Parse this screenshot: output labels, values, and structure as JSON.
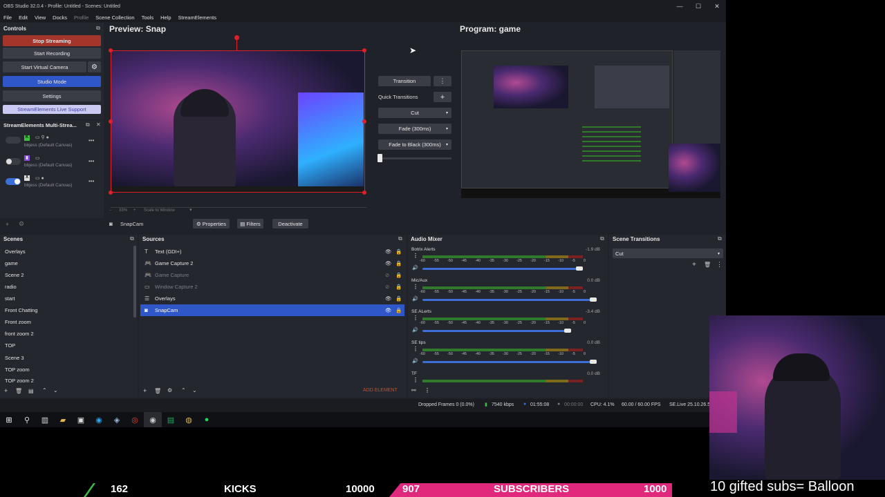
{
  "window": {
    "title": "OBS Studio 32.0.4 - Profile: Untitled - Scenes: Untitled",
    "minimize": "—",
    "maximize": "☐",
    "close": "✕"
  },
  "menu": [
    "File",
    "Edit",
    "View",
    "Docks",
    "Profile",
    "Scene Collection",
    "Tools",
    "Help",
    "StreamElements"
  ],
  "controls": {
    "title": "Controls",
    "stop_streaming": "Stop Streaming",
    "start_recording": "Start Recording",
    "start_virtual_camera": "Start Virtual Camera",
    "studio_mode": "Studio Mode",
    "settings": "Settings",
    "live_support": "StreamElements Live Support"
  },
  "multistream": {
    "title": "StreamElements Multi-Strea...",
    "rows": [
      {
        "label": "bbjess (Default Canvas)"
      },
      {
        "label": "bbjess (Default Canvas)"
      },
      {
        "label": "bbjess (Default Canvas)"
      }
    ]
  },
  "preview": {
    "title": "Preview: Snap",
    "zoom": "33%",
    "scale": "Scale to Window"
  },
  "program": {
    "title": "Program: game"
  },
  "transitions_center": {
    "transition": "Transition",
    "quick_transitions": "Quick Transitions",
    "cut": "Cut",
    "fade": "Fade (300ms)",
    "fade_black": "Fade to Black (300ms)"
  },
  "source_toolbar": {
    "source_name": "SnapCam",
    "properties": "Properties",
    "filters": "Filters",
    "deactivate": "Deactivate"
  },
  "scenes": {
    "title": "Scenes",
    "items": [
      "Overlays",
      "game",
      "Scene 2",
      "radio",
      "start",
      "Front Chatting",
      "Front zoom",
      "front zoom 2",
      "TOP",
      "Scene 3",
      "TOP zoom",
      "TOP zoom 2"
    ]
  },
  "sources": {
    "title": "Sources",
    "items": [
      {
        "name": "Text (GDI+)",
        "icon": "text-icon",
        "glyph": "T"
      },
      {
        "name": "Game Capture 2",
        "icon": "gamepad-icon",
        "glyph": "🎮"
      },
      {
        "name": "Game Capture",
        "icon": "gamepad-icon",
        "glyph": "🎮"
      },
      {
        "name": "Window Capture 2",
        "icon": "window-icon",
        "glyph": "▭"
      },
      {
        "name": "Overlays",
        "icon": "list-icon",
        "glyph": "☰"
      },
      {
        "name": "SnapCam",
        "icon": "camera-icon",
        "glyph": "◙"
      }
    ],
    "add_element": "ADD ELEMENT"
  },
  "mixer": {
    "title": "Audio Mixer",
    "ticks": [
      "-60",
      "-55",
      "-50",
      "-45",
      "-40",
      "-35",
      "-30",
      "-25",
      "-20",
      "-15",
      "-10",
      "-5",
      "0"
    ],
    "channels": [
      {
        "name": "Botrix Alerts",
        "db": "-1.9 dB",
        "level": 0.92
      },
      {
        "name": "Mic/Aux",
        "db": "0.0 dB",
        "level": 1.0
      },
      {
        "name": "SE ALerts",
        "db": "-3.4 dB",
        "level": 0.85
      },
      {
        "name": "SE tips",
        "db": "0.0 dB",
        "level": 1.0
      },
      {
        "name": "TF",
        "db": "0.0 dB",
        "level": 1.0
      }
    ]
  },
  "scene_transitions": {
    "title": "Scene Transitions",
    "selected": "Cut"
  },
  "statusbar": {
    "dropped": "Dropped Frames 0 (0.0%)",
    "kbps": "7540 kbps",
    "stream_time": "01:55:08",
    "rec_time": "00:00:00",
    "cpu": "CPU: 4.1%",
    "fps": "60.00 / 60.00 FPS",
    "version": "SE.Live 25.10.26.5"
  },
  "overlay_bar": {
    "count1": "162",
    "kicks": "KICKS",
    "goal1": "10000",
    "count2": "907",
    "subscribers": "SUBSCRIBERS",
    "goal2": "1000",
    "gift": "10 gifted subs= Balloon"
  },
  "colors": {
    "stop_streaming": "#a3352b",
    "studio_mode": "#2f57c7",
    "accent_blue": "#3c6fd8",
    "selection": "#2f57c7",
    "pink": "#e0287d"
  }
}
